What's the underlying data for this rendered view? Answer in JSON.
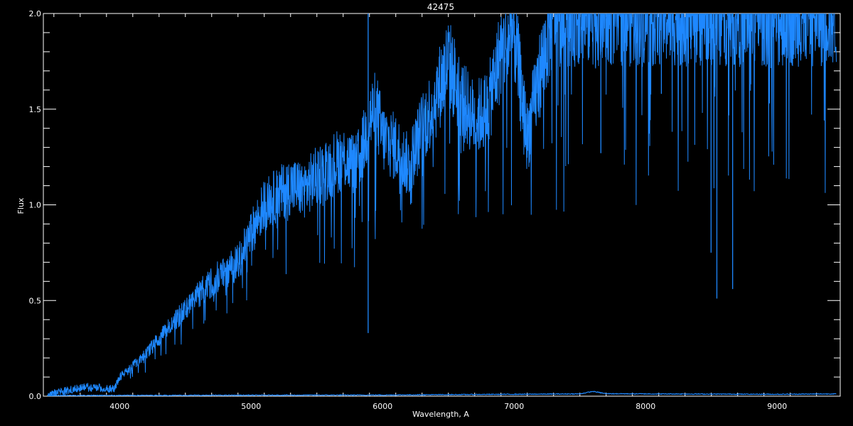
{
  "chart_data": {
    "type": "line",
    "title": "42475",
    "xlabel": "Wavelength, A",
    "ylabel": "Flux",
    "xlim": [
      3420,
      9480
    ],
    "ylim": [
      0.0,
      2.0
    ],
    "x_ticks": [
      4000,
      5000,
      6000,
      7000,
      8000,
      9000
    ],
    "x_tick_labels": [
      "4000",
      "5000",
      "6000",
      "7000",
      "8000",
      "9000"
    ],
    "y_ticks": [
      0.0,
      0.5,
      1.0,
      1.5,
      2.0
    ],
    "y_tick_labels": [
      "0.0",
      "0.5",
      "1.0",
      "1.5",
      "2.0"
    ],
    "grid": false,
    "background": "#000000",
    "axis_color": "#ffffff",
    "line_color": "#1e88ff",
    "series": [
      {
        "role": "flux",
        "x": [
          3450,
          3600,
          3750,
          3900,
          3960,
          4000,
          4100,
          4200,
          4300,
          4400,
          4500,
          4600,
          4700,
          4800,
          4900,
          5000,
          5100,
          5200,
          5300,
          5400,
          5500,
          5600,
          5700,
          5800,
          5850,
          5900,
          5950,
          6000,
          6100,
          6200,
          6300,
          6400,
          6500,
          6600,
          6700,
          6800,
          6900,
          7000,
          7100,
          7200,
          7300,
          7400,
          8000,
          9000,
          9450
        ],
        "y": [
          0.01,
          0.03,
          0.05,
          0.04,
          0.04,
          0.1,
          0.16,
          0.22,
          0.3,
          0.38,
          0.45,
          0.53,
          0.6,
          0.65,
          0.7,
          0.85,
          1.0,
          1.05,
          1.1,
          1.08,
          1.15,
          1.2,
          1.25,
          1.2,
          1.3,
          1.45,
          1.5,
          1.35,
          1.3,
          1.2,
          1.4,
          1.55,
          1.75,
          1.55,
          1.45,
          1.5,
          1.8,
          1.9,
          1.35,
          1.7,
          2.0,
          2.0,
          2.0,
          2.0,
          2.0
        ]
      },
      {
        "role": "error",
        "x": [
          3450,
          4000,
          5000,
          6000,
          7000,
          7500,
          7600,
          7700,
          8000,
          9000,
          9450
        ],
        "y": [
          0.004,
          0.004,
          0.005,
          0.006,
          0.01,
          0.012,
          0.025,
          0.013,
          0.012,
          0.01,
          0.012
        ]
      }
    ],
    "absorption_lines": [
      {
        "x": 5890,
        "y": 0.33
      },
      {
        "x": 7660,
        "y": 1.27
      },
      {
        "x": 8120,
        "y": 1.58
      },
      {
        "x": 8498,
        "y": 0.75
      },
      {
        "x": 8542,
        "y": 0.51
      },
      {
        "x": 8662,
        "y": 0.56
      },
      {
        "x": 8800,
        "y": 1.63
      },
      {
        "x": 9200,
        "y": 1.8
      }
    ]
  }
}
